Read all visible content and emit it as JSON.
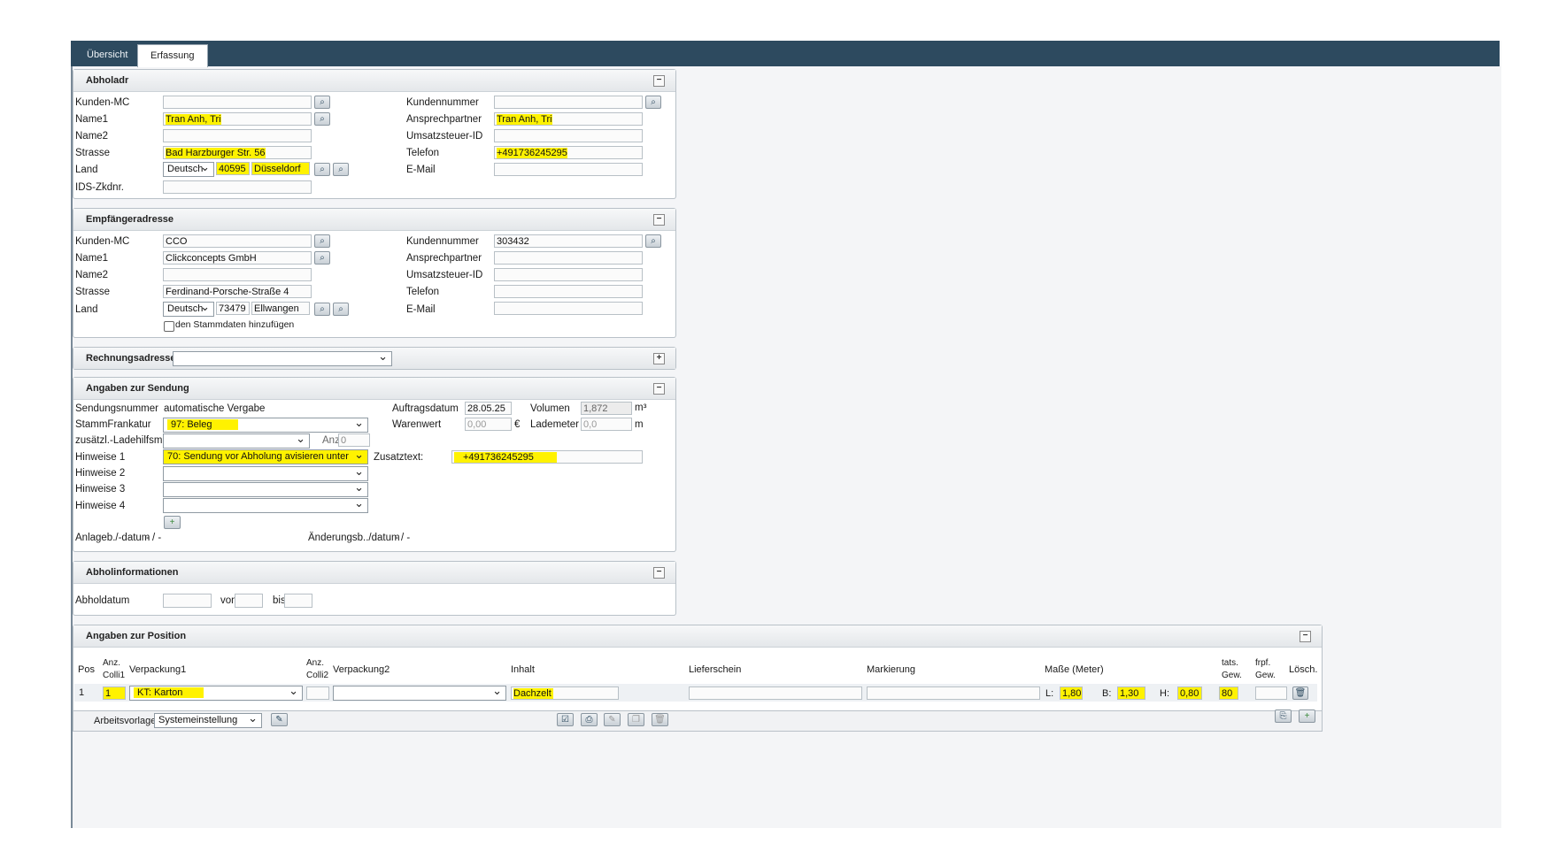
{
  "tabs": [
    "Übersicht",
    "Erfassung"
  ],
  "abholadr": {
    "title": "Abholadr",
    "collapse_icon": "minus-icon",
    "kunden_mc_label": "Kunden-MC",
    "kunden_mc_value": "",
    "name1_label": "Name1",
    "name1_value": "Tran Anh, Tri",
    "name2_label": "Name2",
    "name2_value": "",
    "strasse_label": "Strasse",
    "strasse_value": "Bad Harzburger Str. 56",
    "land_label": "Land",
    "land_value": "Deutsch",
    "plz_value": "40595",
    "ort_value": "Düsseldorf",
    "ids_label": "IDS-Zkdnr.",
    "ids_value": "",
    "kundennummer_label": "Kundennummer",
    "kundennummer_value": "",
    "ansprech_label": "Ansprechpartner",
    "ansprech_value": "Tran Anh, Tri",
    "ust_label": "Umsatzsteuer-ID",
    "ust_value": "",
    "telefon_label": "Telefon",
    "telefon_value": "+491736245295",
    "email_label": "E-Mail",
    "email_value": ""
  },
  "empfaenger": {
    "title": "Empfängeradresse",
    "kunden_mc_label": "Kunden-MC",
    "kunden_mc_value": "CCO",
    "name1_label": "Name1",
    "name1_value": "Clickconcepts GmbH",
    "name2_label": "Name2",
    "name2_value": "",
    "strasse_label": "Strasse",
    "strasse_value": "Ferdinand-Porsche-Straße 4",
    "land_label": "Land",
    "land_value": "Deutsch",
    "plz_value": "73479",
    "ort_value": "Ellwangen",
    "stamm_label": "den Stammdaten hinzufügen",
    "kundennummer_label": "Kundennummer",
    "kundennummer_value": "303432",
    "ansprech_label": "Ansprechpartner",
    "ust_label": "Umsatzsteuer-ID",
    "telefon_label": "Telefon",
    "email_label": "E-Mail"
  },
  "rechnung": {
    "title": "Rechnungsadresse",
    "value": "",
    "expand_icon": "plus-icon"
  },
  "sendung": {
    "title": "Angaben zur Sendung",
    "sendungsnummer_label": "Sendungsnummer",
    "sendungsnummer_value": "automatische Vergabe",
    "stammfrankatur_label": "StammFrankatur",
    "stammfrankatur_value": "97: Beleg",
    "ladehilfsm_label": "zusätzl.-Ladehilfsm.",
    "ladehilfsm_value": "",
    "anz_label": "Anz.",
    "anz_value": "0",
    "hinweise1_label": "Hinweise 1",
    "hinweise1_value": "70: Sendung vor Abholung avisieren unter",
    "hinweise2_label": "Hinweise 2",
    "hinweise3_label": "Hinweise 3",
    "hinweise4_label": "Hinweise 4",
    "zusatztext_label": "Zusatztext:",
    "zusatztext_value": "+491736245295",
    "auftragsdatum_label": "Auftragsdatum",
    "auftragsdatum_value": "28.05.25",
    "volumen_label": "Volumen",
    "volumen_value": "1,872",
    "volumen_unit": "m³",
    "warenwert_label": "Warenwert",
    "warenwert_value": "0,00",
    "warenwert_unit": "€",
    "lademeter_label": "Lademeter",
    "lademeter_value": "0,0",
    "lademeter_unit": "m",
    "anlage_label": "Anlageb./-datum",
    "anlage_value": "- / -",
    "aenderung_label": "Änderungsb../datum",
    "aenderung_value": "- / -"
  },
  "abholinfo": {
    "title": "Abholinformationen",
    "abholdatum_label": "Abholdatum",
    "von_label": "von",
    "bis_label": "bis"
  },
  "position": {
    "title": "Angaben zur Position",
    "headers": {
      "pos": "Pos",
      "anz_colli1_a": "Anz.",
      "anz_colli1_b": "Colli1",
      "verpackung1": "Verpackung1",
      "anz_colli2_a": "Anz.",
      "anz_colli2_b": "Colli2",
      "verpackung2": "Verpackung2",
      "inhalt": "Inhalt",
      "lieferschein": "Lieferschein",
      "markierung": "Markierung",
      "masse": "Maße (Meter)",
      "tats_a": "tats.",
      "tats_b": "Gew.",
      "frpf_a": "frpf.",
      "frpf_b": "Gew.",
      "loesch": "Lösch."
    },
    "row": {
      "pos": "1",
      "colli1": "1",
      "verpackung1": "KT: Karton",
      "colli2": "",
      "verpackung2": "",
      "inhalt": "Dachzelt",
      "lieferschein": "",
      "markierung": "",
      "l_label": "L:",
      "l_value": "1,80",
      "b_label": "B:",
      "b_value": "1,30",
      "h_label": "H:",
      "h_value": "0,80",
      "tats_gew": "80",
      "frpf_gew": ""
    }
  },
  "bottom": {
    "arbeitsvorlage_label": "Arbeitsvorlage",
    "arbeitsvorlage_value": "Systemeinstellung"
  }
}
